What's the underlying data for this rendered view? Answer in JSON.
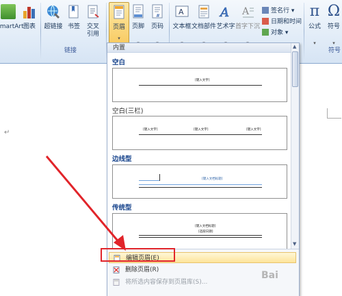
{
  "ribbon": {
    "buttons": [
      {
        "label": "SmartArt"
      },
      {
        "label": "图表"
      },
      {
        "label": "超链接"
      },
      {
        "label": "书签"
      },
      {
        "label": "交叉引用",
        "line1": "交叉",
        "line2": "引用"
      },
      {
        "label": "页眉"
      },
      {
        "label": "页脚"
      },
      {
        "label": "页码"
      },
      {
        "label": "文本框"
      },
      {
        "label": "文档部件"
      },
      {
        "label": "艺术字"
      },
      {
        "label": "首字下沉"
      },
      {
        "label": "公式"
      },
      {
        "label": "符号"
      }
    ],
    "small_buttons": [
      "签名行 ▾",
      "日期和时间",
      "对象 ▾"
    ],
    "groups": {
      "links": "链接",
      "symbols": "符号"
    },
    "colors": {
      "accent": "#f8c95d",
      "text": "#1e395b"
    }
  },
  "gallery": {
    "header": "内置",
    "sections": [
      {
        "name": "空白",
        "texts": [
          "[键入文字]"
        ]
      },
      {
        "name": "空白(三栏)",
        "texts": [
          "[键入文字]",
          "[键入文字]",
          "[键入文字]"
        ]
      },
      {
        "name": "边线型",
        "texts": [
          "[键入文档标题]"
        ]
      },
      {
        "name": "传统型",
        "texts": [
          "[键入文档标题]",
          "[选取日期]"
        ]
      }
    ],
    "menu": [
      {
        "label": "编辑页眉(E)",
        "icon": "edit-header-icon"
      },
      {
        "label": "删除页眉(R)",
        "icon": "delete-header-icon"
      },
      {
        "label": "将所选内容保存到页眉库(S)...",
        "icon": "save-selection-icon"
      }
    ]
  },
  "doc": {
    "return_mark": "↵"
  },
  "watermark": "Bai"
}
